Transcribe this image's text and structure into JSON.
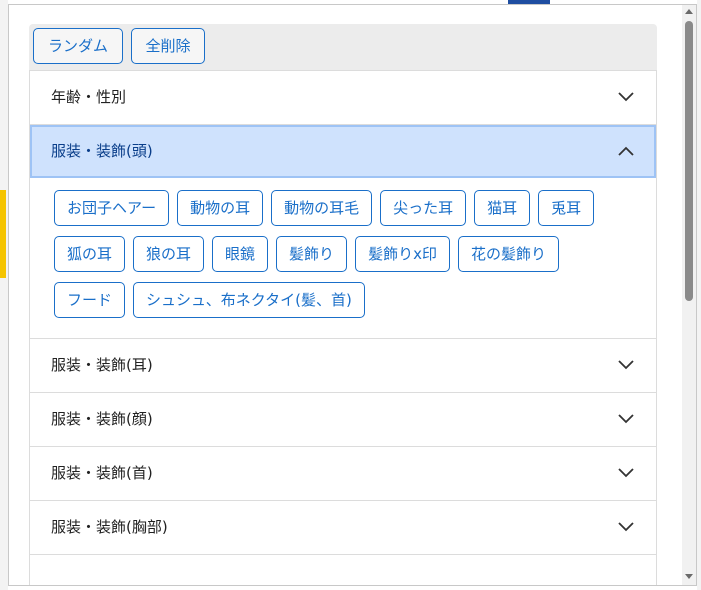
{
  "toolbar": {
    "random_label": "ランダム",
    "clear_all_label": "全削除"
  },
  "sections": [
    {
      "label": "年齢・性別",
      "open": false
    },
    {
      "label": "服装・装飾(頭)",
      "open": true
    },
    {
      "label": "服装・装飾(耳)",
      "open": false
    },
    {
      "label": "服装・装飾(顔)",
      "open": false
    },
    {
      "label": "服装・装飾(首)",
      "open": false
    },
    {
      "label": "服装・装飾(胸部)",
      "open": false
    }
  ],
  "head_tags": [
    [
      "お団子ヘアー",
      "動物の耳",
      "動物の耳毛",
      "尖った耳",
      "猫耳",
      "兎耳"
    ],
    [
      "狐の耳",
      "狼の耳",
      "眼鏡",
      "髪飾り",
      "髪飾りx印",
      "花の髪飾り"
    ],
    [
      "フード",
      "シュシュ、布ネクタイ(髪、首)"
    ]
  ],
  "colors": {
    "accent": "#1a6fc9",
    "open_header_bg": "#cfe2fd"
  }
}
